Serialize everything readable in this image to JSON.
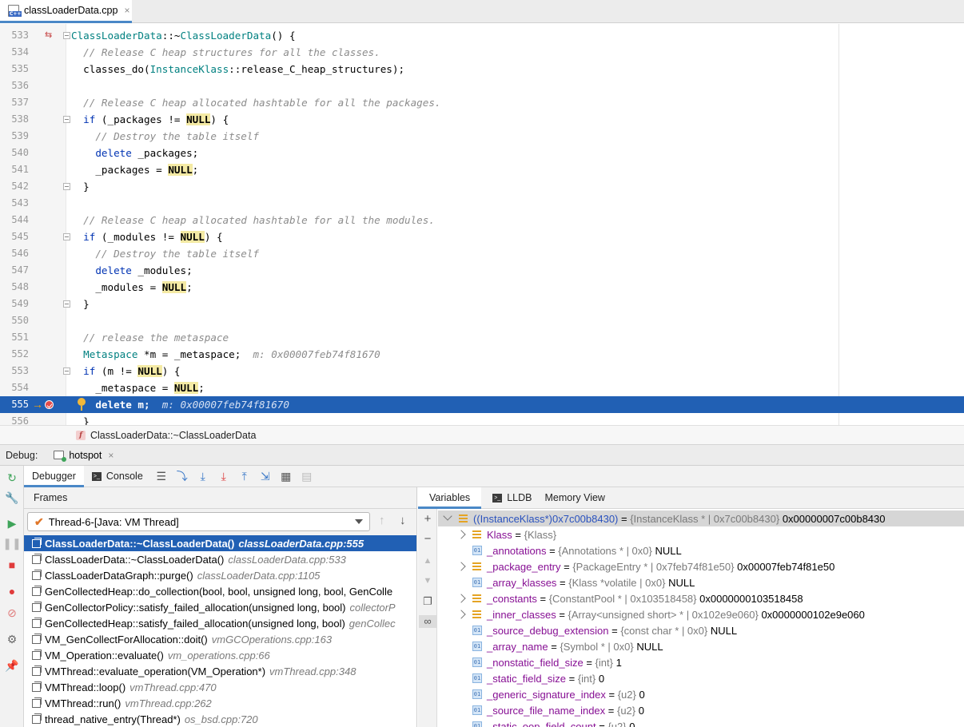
{
  "editor_tab": {
    "label": "classLoaderData.cpp",
    "icon": "cpp-file-icon",
    "close": "×"
  },
  "code_lines": [
    {
      "num": "533",
      "segments": [
        {
          "t": "ClassLoaderData",
          "c": "ty"
        },
        {
          "t": "::~",
          "c": ""
        },
        {
          "t": "ClassLoaderData",
          "c": "ty"
        },
        {
          "t": "() {",
          "c": ""
        }
      ]
    },
    {
      "num": "534",
      "segments": [
        {
          "t": "  // Release C heap structures for all the classes.",
          "c": "cm"
        }
      ]
    },
    {
      "num": "535",
      "segments": [
        {
          "t": "  classes_do(",
          "c": ""
        },
        {
          "t": "InstanceKlass",
          "c": "ty"
        },
        {
          "t": "::release_C_heap_structures);",
          "c": ""
        }
      ]
    },
    {
      "num": "536",
      "segments": []
    },
    {
      "num": "537",
      "segments": [
        {
          "t": "  // Release C heap allocated hashtable for all the packages.",
          "c": "cm"
        }
      ]
    },
    {
      "num": "538",
      "segments": [
        {
          "t": "  ",
          "c": ""
        },
        {
          "t": "if",
          "c": "kw"
        },
        {
          "t": " (_packages != ",
          "c": ""
        },
        {
          "t": "NULL",
          "c": "nl"
        },
        {
          "t": ") {",
          "c": ""
        }
      ]
    },
    {
      "num": "539",
      "segments": [
        {
          "t": "    // Destroy the table itself",
          "c": "cm"
        }
      ]
    },
    {
      "num": "540",
      "segments": [
        {
          "t": "    ",
          "c": ""
        },
        {
          "t": "delete",
          "c": "kw"
        },
        {
          "t": " _packages;",
          "c": ""
        }
      ]
    },
    {
      "num": "541",
      "segments": [
        {
          "t": "    _packages = ",
          "c": ""
        },
        {
          "t": "NULL",
          "c": "nl"
        },
        {
          "t": ";",
          "c": ""
        }
      ]
    },
    {
      "num": "542",
      "segments": [
        {
          "t": "  }",
          "c": ""
        }
      ]
    },
    {
      "num": "543",
      "segments": []
    },
    {
      "num": "544",
      "segments": [
        {
          "t": "  // Release C heap allocated hashtable for all the modules.",
          "c": "cm"
        }
      ]
    },
    {
      "num": "545",
      "segments": [
        {
          "t": "  ",
          "c": ""
        },
        {
          "t": "if",
          "c": "kw"
        },
        {
          "t": " (_modules != ",
          "c": ""
        },
        {
          "t": "NULL",
          "c": "nl"
        },
        {
          "t": ") {",
          "c": ""
        }
      ]
    },
    {
      "num": "546",
      "segments": [
        {
          "t": "    // Destroy the table itself",
          "c": "cm"
        }
      ]
    },
    {
      "num": "547",
      "segments": [
        {
          "t": "    ",
          "c": ""
        },
        {
          "t": "delete",
          "c": "kw"
        },
        {
          "t": " _modules;",
          "c": ""
        }
      ]
    },
    {
      "num": "548",
      "segments": [
        {
          "t": "    _modules = ",
          "c": ""
        },
        {
          "t": "NULL",
          "c": "nl"
        },
        {
          "t": ";",
          "c": ""
        }
      ]
    },
    {
      "num": "549",
      "segments": [
        {
          "t": "  }",
          "c": ""
        }
      ]
    },
    {
      "num": "550",
      "segments": []
    },
    {
      "num": "551",
      "segments": [
        {
          "t": "  // release the metaspace",
          "c": "cm"
        }
      ]
    },
    {
      "num": "552",
      "segments": [
        {
          "t": "  ",
          "c": ""
        },
        {
          "t": "Metaspace",
          "c": "ty"
        },
        {
          "t": " *m = _metaspace;  ",
          "c": ""
        },
        {
          "t": "m: 0x00007feb74f81670",
          "c": "inl"
        }
      ]
    },
    {
      "num": "553",
      "segments": [
        {
          "t": "  ",
          "c": ""
        },
        {
          "t": "if",
          "c": "kw"
        },
        {
          "t": " (m != ",
          "c": ""
        },
        {
          "t": "NULL",
          "c": "nl"
        },
        {
          "t": ") {",
          "c": ""
        }
      ]
    },
    {
      "num": "554",
      "segments": [
        {
          "t": "    _metaspace = ",
          "c": ""
        },
        {
          "t": "NULL",
          "c": "nl"
        },
        {
          "t": ";",
          "c": ""
        }
      ]
    },
    {
      "num": "555",
      "segments": [
        {
          "t": "    delete m;  ",
          "c": ""
        },
        {
          "t": "m: 0x00007feb74f81670",
          "c": "inl"
        }
      ]
    },
    {
      "num": "556",
      "segments": [
        {
          "t": "  }",
          "c": ""
        }
      ]
    }
  ],
  "breadcrumb": {
    "badge": "f",
    "label": "ClassLoaderData::~ClassLoaderData"
  },
  "debug": {
    "label": "Debug:",
    "session": "hotspot",
    "session_close": "×",
    "tabs": {
      "debugger": "Debugger",
      "console": "Console"
    }
  },
  "frames": {
    "header": "Frames",
    "thread": "Thread-6-[Java: VM Thread]",
    "list": [
      {
        "fn": "ClassLoaderData::~ClassLoaderData()",
        "loc": "classLoaderData.cpp:555"
      },
      {
        "fn": "ClassLoaderData::~ClassLoaderData()",
        "loc": "classLoaderData.cpp:533"
      },
      {
        "fn": "ClassLoaderDataGraph::purge()",
        "loc": "classLoaderData.cpp:1105"
      },
      {
        "fn": "GenCollectedHeap::do_collection(bool, bool, unsigned long, bool, GenColle",
        "loc": ""
      },
      {
        "fn": "GenCollectorPolicy::satisfy_failed_allocation(unsigned long, bool)",
        "loc": "collectorP"
      },
      {
        "fn": "GenCollectedHeap::satisfy_failed_allocation(unsigned long, bool)",
        "loc": "genCollec"
      },
      {
        "fn": "VM_GenCollectForAllocation::doit()",
        "loc": "vmGCOperations.cpp:163"
      },
      {
        "fn": "VM_Operation::evaluate()",
        "loc": "vm_operations.cpp:66"
      },
      {
        "fn": "VMThread::evaluate_operation(VM_Operation*)",
        "loc": "vmThread.cpp:348"
      },
      {
        "fn": "VMThread::loop()",
        "loc": "vmThread.cpp:470"
      },
      {
        "fn": "VMThread::run()",
        "loc": "vmThread.cpp:262"
      },
      {
        "fn": "thread_native_entry(Thread*)",
        "loc": "os_bsd.cpp:720"
      }
    ]
  },
  "variables_tabs": {
    "variables": "Variables",
    "lldb": "LLDB",
    "memory": "Memory View"
  },
  "variables": [
    {
      "indent": 0,
      "expand": "open",
      "icon": "struct",
      "name": "((InstanceKlass*)0x7c00b8430)",
      "type": "{InstanceKlass * | 0x7c00b8430}",
      "value": "0x00000007c00b8430",
      "root": true
    },
    {
      "indent": 1,
      "expand": "closed",
      "icon": "struct",
      "name": "Klass",
      "type": "{Klass}",
      "value": ""
    },
    {
      "indent": 1,
      "expand": "",
      "icon": "prim",
      "name": "_annotations",
      "type": "{Annotations * | 0x0}",
      "value": "NULL"
    },
    {
      "indent": 1,
      "expand": "closed",
      "icon": "struct",
      "name": "_package_entry",
      "type": "{PackageEntry * | 0x7feb74f81e50}",
      "value": "0x00007feb74f81e50"
    },
    {
      "indent": 1,
      "expand": "",
      "icon": "prim",
      "name": "_array_klasses",
      "type": "{Klass *volatile | 0x0}",
      "value": "NULL"
    },
    {
      "indent": 1,
      "expand": "closed",
      "icon": "struct",
      "name": "_constants",
      "type": "{ConstantPool * | 0x103518458}",
      "value": "0x0000000103518458"
    },
    {
      "indent": 1,
      "expand": "closed",
      "icon": "struct",
      "name": "_inner_classes",
      "type": "{Array<unsigned short> * | 0x102e9e060}",
      "value": "0x0000000102e9e060"
    },
    {
      "indent": 1,
      "expand": "",
      "icon": "prim",
      "name": "_source_debug_extension",
      "type": "{const char * | 0x0}",
      "value": "NULL"
    },
    {
      "indent": 1,
      "expand": "",
      "icon": "prim",
      "name": "_array_name",
      "type": "{Symbol * | 0x0}",
      "value": "NULL"
    },
    {
      "indent": 1,
      "expand": "",
      "icon": "prim",
      "name": "_nonstatic_field_size",
      "type": "{int}",
      "value": "1"
    },
    {
      "indent": 1,
      "expand": "",
      "icon": "prim",
      "name": "_static_field_size",
      "type": "{int}",
      "value": "0"
    },
    {
      "indent": 1,
      "expand": "",
      "icon": "prim",
      "name": "_generic_signature_index",
      "type": "{u2}",
      "value": "0"
    },
    {
      "indent": 1,
      "expand": "",
      "icon": "prim",
      "name": "_source_file_name_index",
      "type": "{u2}",
      "value": "0"
    },
    {
      "indent": 1,
      "expand": "",
      "icon": "prim",
      "name": "_static_oop_field_count",
      "type": "{u2}",
      "value": "0"
    }
  ],
  "prim_icon_text": "01"
}
